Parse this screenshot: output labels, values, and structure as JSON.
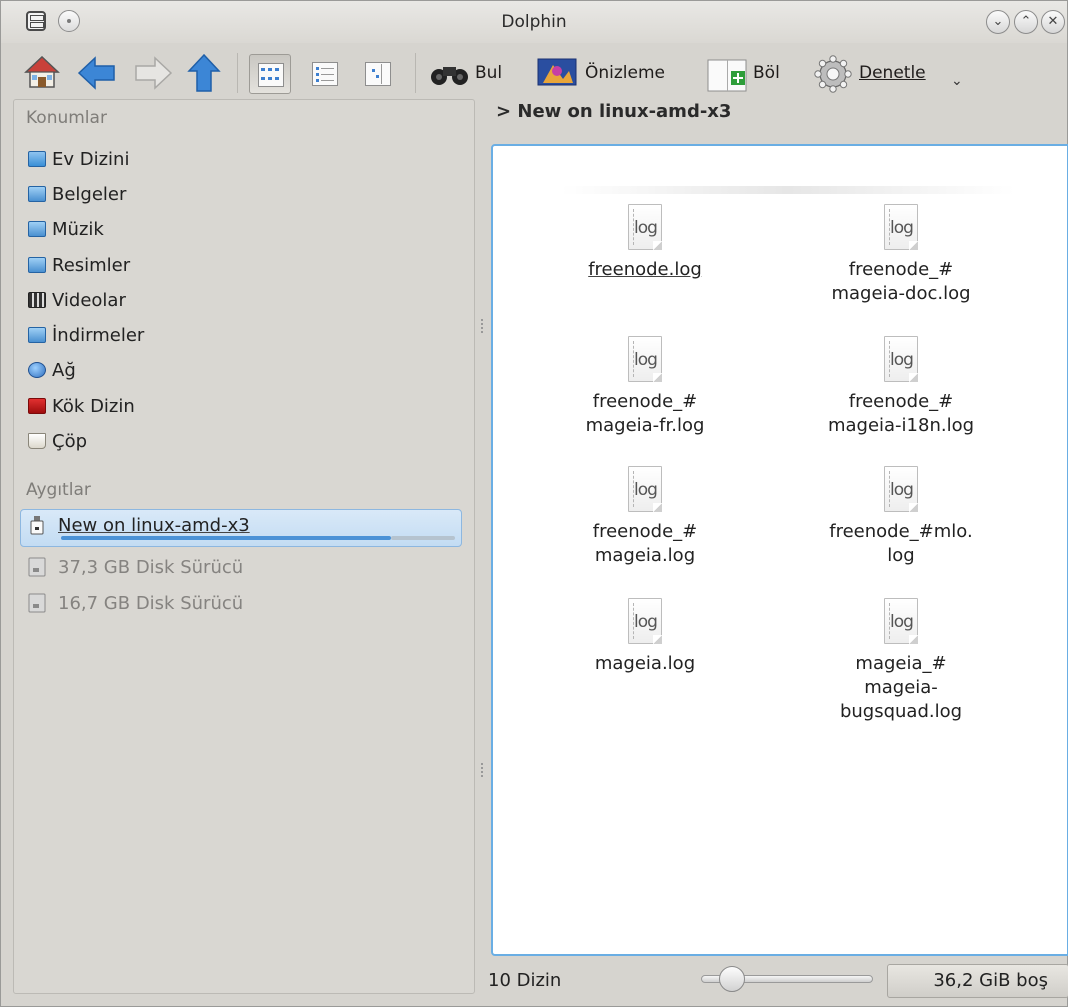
{
  "window": {
    "title": "Dolphin"
  },
  "toolbar": {
    "find_label": "Bul",
    "preview_label": "Önizleme",
    "split_label": "Böl",
    "control_label": "Denetle"
  },
  "sidebar": {
    "places_header": "Konumlar",
    "places": [
      {
        "label": "Ev Dizini",
        "icon": "home-folder-icon",
        "color": "#3a8fd6"
      },
      {
        "label": "Belgeler",
        "icon": "documents-folder-icon",
        "color": "#4a90d0"
      },
      {
        "label": "Müzik",
        "icon": "music-folder-icon",
        "color": "#4a90d0"
      },
      {
        "label": "Resimler",
        "icon": "pictures-folder-icon",
        "color": "#4a90d0"
      },
      {
        "label": "Videolar",
        "icon": "videos-folder-icon",
        "color": "#333333"
      },
      {
        "label": "İndirmeler",
        "icon": "downloads-folder-icon",
        "color": "#4a90d0"
      },
      {
        "label": "Ağ",
        "icon": "network-globe-icon",
        "color": "#2f6fbf"
      },
      {
        "label": "Kök Dizin",
        "icon": "root-folder-icon",
        "color": "#c01818"
      },
      {
        "label": "Çöp",
        "icon": "trash-icon",
        "color": "#e9e6dd"
      }
    ],
    "devices_header": "Aygıtlar",
    "devices": [
      {
        "label": "New on linux-amd-x3",
        "icon": "usb-drive-icon"
      },
      {
        "label": "37,3 GB Disk Sürücü",
        "icon": "hard-disk-icon"
      },
      {
        "label": "16,7 GB Disk Sürücü",
        "icon": "hard-disk-icon"
      }
    ]
  },
  "breadcrumb": {
    "separator": ">",
    "current": "New on linux-amd-x3"
  },
  "files": [
    {
      "name": "freenode.log",
      "ext": "log"
    },
    {
      "name": "freenode_#\nmageia-doc.log",
      "ext": "log"
    },
    {
      "name": "freenode_#\nmageia-fr.log",
      "ext": "log"
    },
    {
      "name": "freenode_#\nmageia-i18n.log",
      "ext": "log"
    },
    {
      "name": "freenode_#\nmageia.log",
      "ext": "log"
    },
    {
      "name": "freenode_#mlo.\nlog",
      "ext": "log"
    },
    {
      "name": "mageia.log",
      "ext": "log"
    },
    {
      "name": "mageia_#\nmageia-\nbugsquad.log",
      "ext": "log"
    }
  ],
  "status": {
    "item_count": "10 Dizin",
    "free_space": "36,2 GiB boş"
  },
  "colors": {
    "accent": "#6aaee4",
    "selection": "#c3dcf3"
  }
}
